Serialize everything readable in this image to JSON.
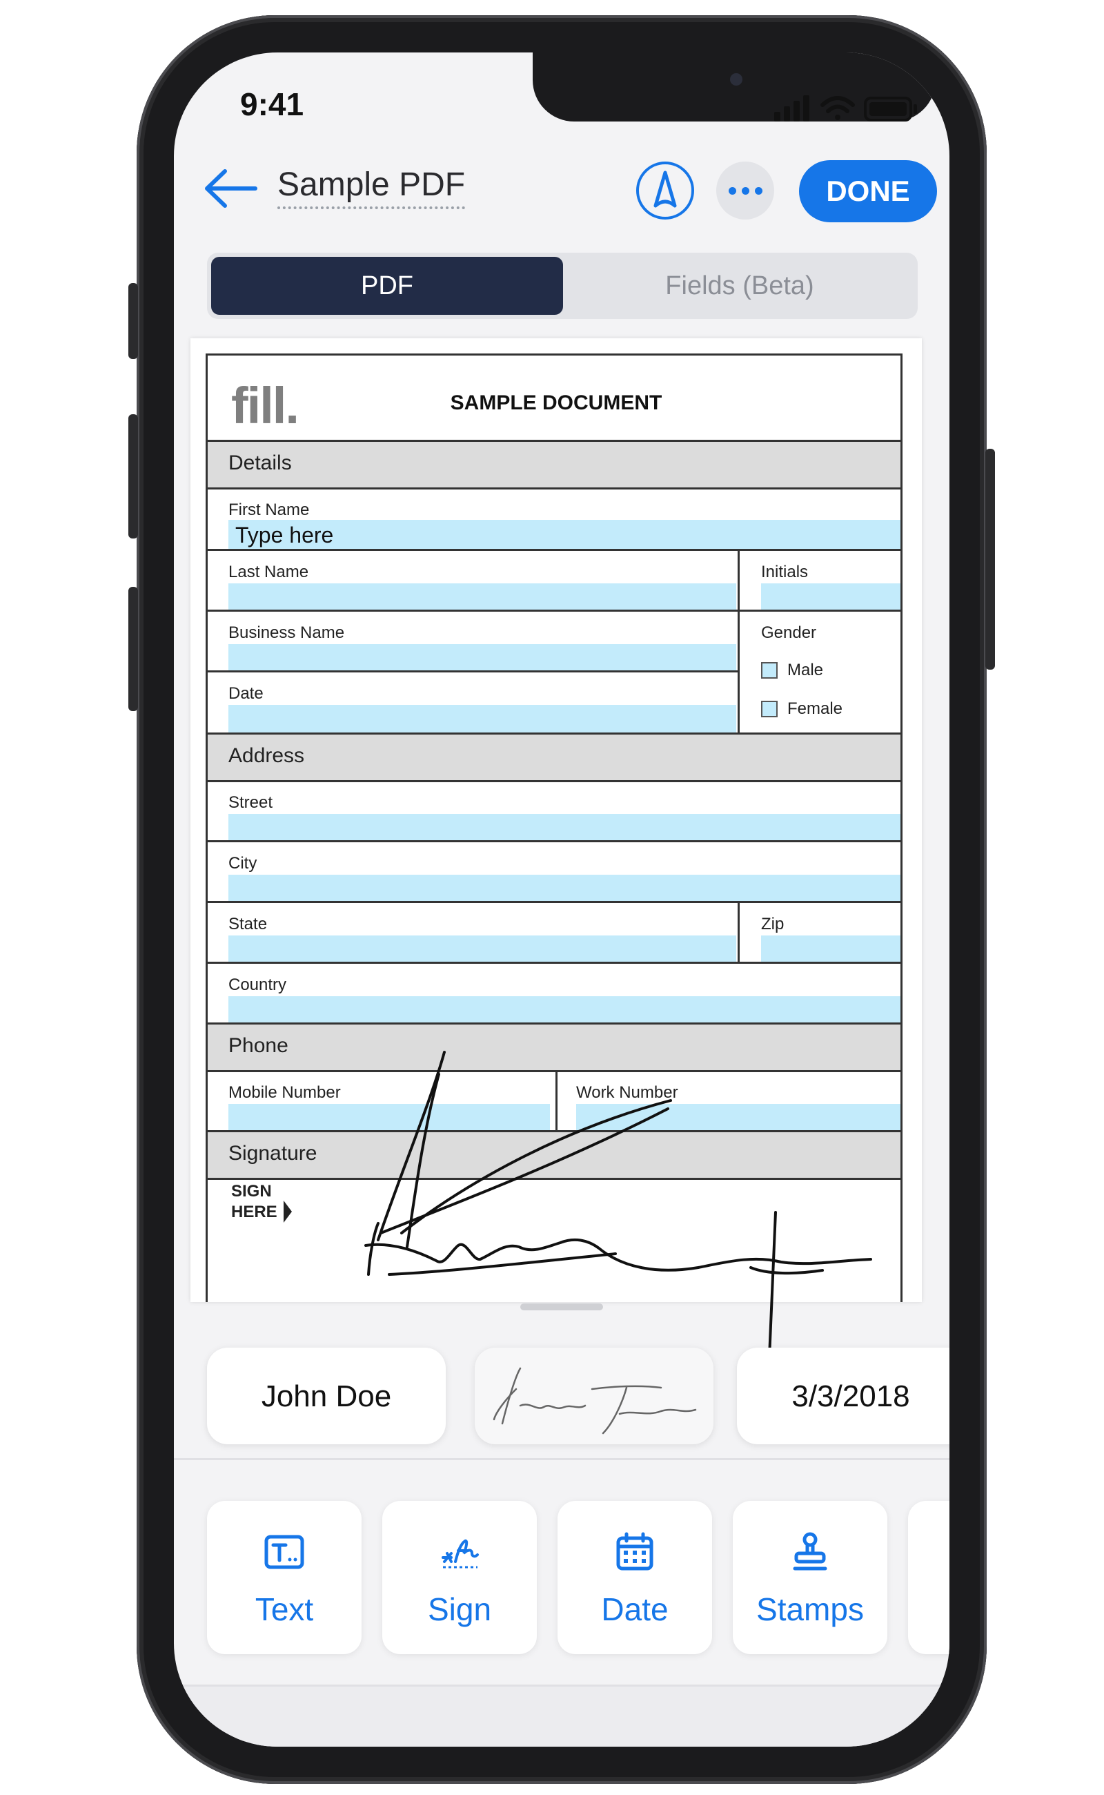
{
  "status_bar": {
    "time": "9:41"
  },
  "header": {
    "title": "Sample PDF",
    "done_label": "DONE",
    "back_icon": "arrow-left-icon",
    "pen_icon": "pen-nib-icon",
    "more_icon": "ellipsis-icon"
  },
  "segments": {
    "pdf": "PDF",
    "fields": "Fields (Beta)",
    "selected": "PDF"
  },
  "document": {
    "logo": "fill.",
    "heading": "SAMPLE DOCUMENT",
    "sections": {
      "details": "Details",
      "address": "Address",
      "phone": "Phone",
      "signature": "Signature"
    },
    "fields": {
      "first_name": {
        "label": "First Name",
        "value": "Type here"
      },
      "last_name": "Last Name",
      "initials": "Initials",
      "business_name": "Business Name",
      "gender": "Gender",
      "male": "Male",
      "female": "Female",
      "date": "Date",
      "street": "Street",
      "city": "City",
      "state": "State",
      "zip": "Zip",
      "country": "Country",
      "mobile_number": "Mobile Number",
      "work_number": "Work Number"
    },
    "sign_here": {
      "line1": "SIGN",
      "line2": "HERE"
    }
  },
  "quick_fill": {
    "name": "John Doe",
    "date": "3/3/2018"
  },
  "tools": [
    {
      "label": "Text",
      "icon": "text-box-icon"
    },
    {
      "label": "Sign",
      "icon": "signature-icon"
    },
    {
      "label": "Date",
      "icon": "calendar-icon"
    },
    {
      "label": "Stamps",
      "icon": "stamp-icon"
    }
  ],
  "colors": {
    "accent": "#1676e8",
    "segment_selected": "#222c47",
    "field_fill": "#c3ebfb",
    "section_gray": "#dcdcdc"
  }
}
